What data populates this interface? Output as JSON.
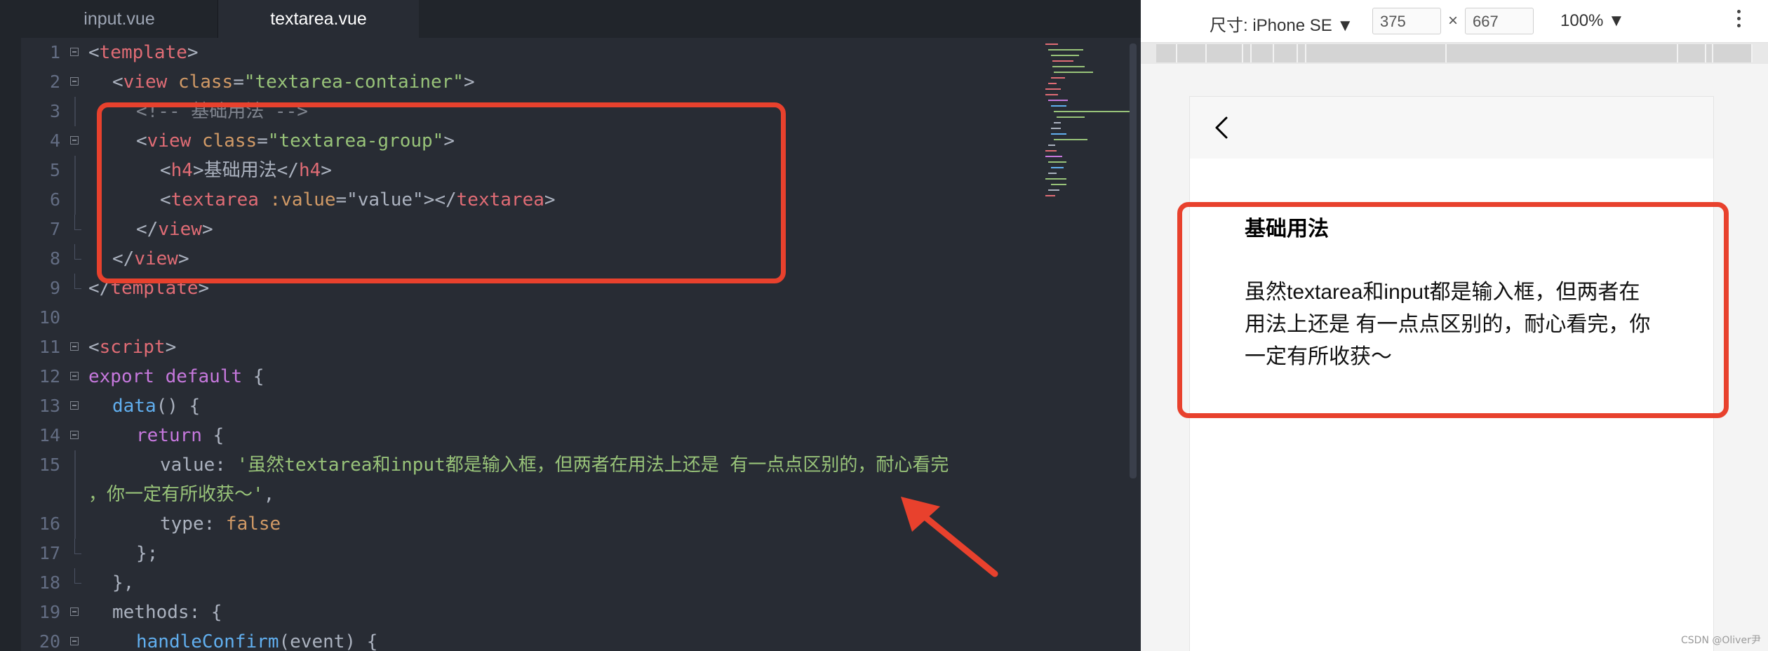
{
  "editor": {
    "tabs": [
      {
        "label": "input.vue",
        "active": false
      },
      {
        "label": "textarea.vue",
        "active": true
      }
    ],
    "lines": [
      {
        "n": "1",
        "fold": "open",
        "indent": 0,
        "parts": [
          [
            "punct",
            "<"
          ],
          [
            "tag",
            "template"
          ],
          [
            "punct",
            ">"
          ]
        ]
      },
      {
        "n": "2",
        "fold": "open",
        "indent": 1,
        "parts": [
          [
            "punct",
            "<"
          ],
          [
            "tag",
            "view "
          ],
          [
            "attr",
            "class"
          ],
          [
            "punct",
            "="
          ],
          [
            "str",
            "\"textarea-container\""
          ],
          [
            "punct",
            ">"
          ]
        ]
      },
      {
        "n": "3",
        "fold": "line",
        "indent": 2,
        "parts": [
          [
            "cmt",
            "<!-- 基础用法 -->"
          ]
        ]
      },
      {
        "n": "4",
        "fold": "open",
        "indent": 2,
        "parts": [
          [
            "punct",
            "<"
          ],
          [
            "tag",
            "view "
          ],
          [
            "attr",
            "class"
          ],
          [
            "punct",
            "="
          ],
          [
            "str",
            "\"textarea-group\""
          ],
          [
            "punct",
            ">"
          ]
        ]
      },
      {
        "n": "5",
        "fold": "line",
        "indent": 3,
        "parts": [
          [
            "punct",
            "<"
          ],
          [
            "tag",
            "h4"
          ],
          [
            "punct",
            ">基础用法</"
          ],
          [
            "tag",
            "h4"
          ],
          [
            "punct",
            ">"
          ]
        ]
      },
      {
        "n": "6",
        "fold": "line",
        "indent": 3,
        "parts": [
          [
            "punct",
            "<"
          ],
          [
            "tag",
            "textarea "
          ],
          [
            "attr",
            ":value"
          ],
          [
            "punct",
            "=\"value\"></"
          ],
          [
            "tag",
            "textarea"
          ],
          [
            "punct",
            ">"
          ]
        ]
      },
      {
        "n": "7",
        "fold": "end",
        "indent": 2,
        "parts": [
          [
            "punct",
            "</"
          ],
          [
            "tag",
            "view"
          ],
          [
            "punct",
            ">"
          ]
        ]
      },
      {
        "n": "8",
        "fold": "end",
        "indent": 1,
        "parts": [
          [
            "punct",
            "</"
          ],
          [
            "tag",
            "view"
          ],
          [
            "punct",
            ">"
          ]
        ]
      },
      {
        "n": "9",
        "fold": "end",
        "indent": 0,
        "parts": [
          [
            "punct",
            "</"
          ],
          [
            "tag",
            "template"
          ],
          [
            "punct",
            ">"
          ]
        ]
      },
      {
        "n": "10",
        "fold": "none",
        "indent": 0,
        "parts": []
      },
      {
        "n": "11",
        "fold": "open",
        "indent": 0,
        "parts": [
          [
            "punct",
            "<"
          ],
          [
            "tag",
            "script"
          ],
          [
            "punct",
            ">"
          ]
        ]
      },
      {
        "n": "12",
        "fold": "open",
        "indent": 0,
        "parts": [
          [
            "kw",
            "export default "
          ],
          [
            "punct",
            "{"
          ]
        ]
      },
      {
        "n": "13",
        "fold": "open",
        "indent": 1,
        "parts": [
          [
            "fn",
            "data"
          ],
          [
            "punct",
            "() {"
          ]
        ]
      },
      {
        "n": "14",
        "fold": "open",
        "indent": 2,
        "parts": [
          [
            "kw",
            "return "
          ],
          [
            "punct",
            "{"
          ]
        ]
      },
      {
        "n": "15",
        "fold": "line",
        "indent": 3,
        "parts": [
          [
            "punct",
            "value: "
          ],
          [
            "str",
            "'虽然textarea和input都是输入框，但两者在用法上还是 有一点点区别的，耐心看完"
          ]
        ]
      },
      {
        "n": "",
        "fold": "line",
        "indent": 0,
        "parts": [
          [
            "str",
            "，你一定有所收获～'"
          ],
          [
            "punct",
            ","
          ]
        ]
      },
      {
        "n": "16",
        "fold": "line",
        "indent": 3,
        "parts": [
          [
            "punct",
            "type: "
          ],
          [
            "bool",
            "false"
          ]
        ]
      },
      {
        "n": "17",
        "fold": "end",
        "indent": 2,
        "parts": [
          [
            "punct",
            "};"
          ]
        ]
      },
      {
        "n": "18",
        "fold": "end",
        "indent": 1,
        "parts": [
          [
            "punct",
            "},"
          ]
        ]
      },
      {
        "n": "19",
        "fold": "open",
        "indent": 1,
        "parts": [
          [
            "punct",
            "methods: {"
          ]
        ]
      },
      {
        "n": "20",
        "fold": "open",
        "indent": 2,
        "parts": [
          [
            "fn",
            "handleConfirm"
          ],
          [
            "punct",
            "(event) {"
          ]
        ]
      }
    ]
  },
  "simulator": {
    "device": "尺寸: iPhone SE ▼",
    "width": "375",
    "times": "×",
    "height": "667",
    "zoom": "100% ▼",
    "page": {
      "heading": "基础用法",
      "textarea_value": "虽然textarea和input都是输入框，但两者在用法上还是 有一点点区别的，耐心看完，你一定有所收获～"
    }
  },
  "watermark": "CSDN @Oliver尹",
  "colors": {
    "highlight": "#e8412d",
    "editor_bg": "#282c34"
  }
}
